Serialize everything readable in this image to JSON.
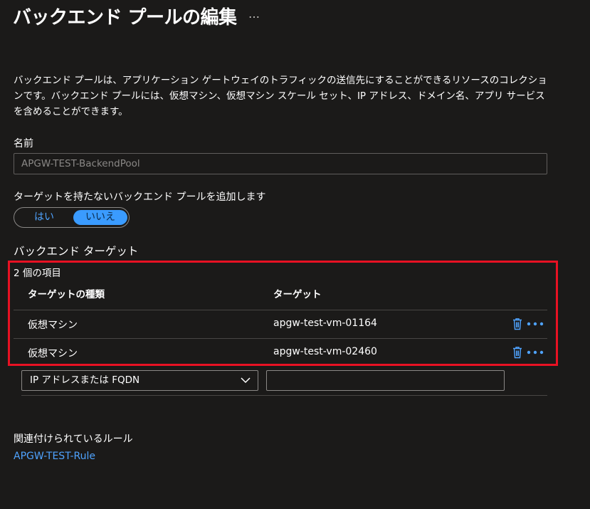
{
  "header": {
    "title": "バックエンド プールの編集",
    "more_label": "…"
  },
  "description": "バックエンド プールは、アプリケーション ゲートウェイのトラフィックの送信先にすることができるリソースのコレクションです。バックエンド プールには、仮想マシン、仮想マシン スケール セット、IP アドレス、ドメイン名、アプリ サービスを含めることができます。",
  "name_field": {
    "label": "名前",
    "value": "APGW-TEST-BackendPool"
  },
  "no_target_toggle": {
    "label": "ターゲットを持たないバックエンド プールを追加します",
    "options": [
      "はい",
      "いいえ"
    ],
    "selected": "いいえ"
  },
  "backend_targets": {
    "section_title": "バックエンド ターゲット",
    "item_count": "2 個の項目",
    "columns": [
      "ターゲットの種類",
      "ターゲット"
    ],
    "rows": [
      {
        "type": "仮想マシン",
        "target": "apgw-test-vm-01164"
      },
      {
        "type": "仮想マシン",
        "target": "apgw-test-vm-02460"
      }
    ]
  },
  "new_row": {
    "type_select_value": "IP アドレスまたは FQDN",
    "target_input_value": ""
  },
  "associated_rules": {
    "label": "関連付けられているルール",
    "link": "APGW-TEST-Rule"
  },
  "colors": {
    "background": "#1b1a19",
    "accent": "#4fa3ff",
    "toggle_selected": "#3a9bff",
    "highlight_border": "#e81123"
  },
  "icons": [
    "more-horizontal-icon",
    "trash-icon",
    "chevron-down-icon"
  ]
}
